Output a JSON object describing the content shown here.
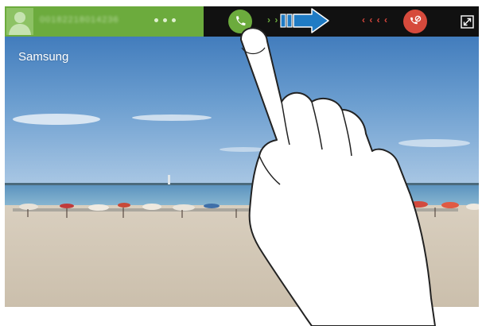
{
  "incoming_call": {
    "caller_number": "00182218014236",
    "avatar_icon": "person-silhouette-icon",
    "answer_icon": "phone-handset-icon",
    "decline_icon": "phone-hangup-icon",
    "expand_icon": "expand-arrows-icon",
    "answer_chevrons": "› › ›",
    "decline_chevrons": "‹ ‹ ‹ ‹",
    "colors": {
      "answer": "#6cab3d",
      "decline": "#d64a3c",
      "bar_background": "#111111"
    }
  },
  "background": {
    "carrier_text": "Samsung"
  },
  "overlay": {
    "swipe_arrow_color": "#1f7bc4",
    "gesture": "finger-swipe-right"
  }
}
